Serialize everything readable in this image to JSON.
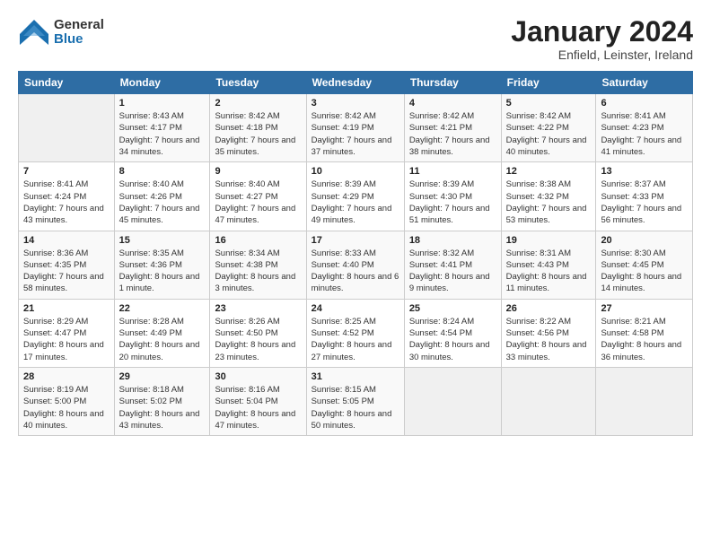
{
  "header": {
    "logo_general": "General",
    "logo_blue": "Blue",
    "month": "January 2024",
    "location": "Enfield, Leinster, Ireland"
  },
  "weekdays": [
    "Sunday",
    "Monday",
    "Tuesday",
    "Wednesday",
    "Thursday",
    "Friday",
    "Saturday"
  ],
  "weeks": [
    [
      {
        "day": "",
        "sunrise": "",
        "sunset": "",
        "daylight": ""
      },
      {
        "day": "1",
        "sunrise": "Sunrise: 8:43 AM",
        "sunset": "Sunset: 4:17 PM",
        "daylight": "Daylight: 7 hours and 34 minutes."
      },
      {
        "day": "2",
        "sunrise": "Sunrise: 8:42 AM",
        "sunset": "Sunset: 4:18 PM",
        "daylight": "Daylight: 7 hours and 35 minutes."
      },
      {
        "day": "3",
        "sunrise": "Sunrise: 8:42 AM",
        "sunset": "Sunset: 4:19 PM",
        "daylight": "Daylight: 7 hours and 37 minutes."
      },
      {
        "day": "4",
        "sunrise": "Sunrise: 8:42 AM",
        "sunset": "Sunset: 4:21 PM",
        "daylight": "Daylight: 7 hours and 38 minutes."
      },
      {
        "day": "5",
        "sunrise": "Sunrise: 8:42 AM",
        "sunset": "Sunset: 4:22 PM",
        "daylight": "Daylight: 7 hours and 40 minutes."
      },
      {
        "day": "6",
        "sunrise": "Sunrise: 8:41 AM",
        "sunset": "Sunset: 4:23 PM",
        "daylight": "Daylight: 7 hours and 41 minutes."
      }
    ],
    [
      {
        "day": "7",
        "sunrise": "Sunrise: 8:41 AM",
        "sunset": "Sunset: 4:24 PM",
        "daylight": "Daylight: 7 hours and 43 minutes."
      },
      {
        "day": "8",
        "sunrise": "Sunrise: 8:40 AM",
        "sunset": "Sunset: 4:26 PM",
        "daylight": "Daylight: 7 hours and 45 minutes."
      },
      {
        "day": "9",
        "sunrise": "Sunrise: 8:40 AM",
        "sunset": "Sunset: 4:27 PM",
        "daylight": "Daylight: 7 hours and 47 minutes."
      },
      {
        "day": "10",
        "sunrise": "Sunrise: 8:39 AM",
        "sunset": "Sunset: 4:29 PM",
        "daylight": "Daylight: 7 hours and 49 minutes."
      },
      {
        "day": "11",
        "sunrise": "Sunrise: 8:39 AM",
        "sunset": "Sunset: 4:30 PM",
        "daylight": "Daylight: 7 hours and 51 minutes."
      },
      {
        "day": "12",
        "sunrise": "Sunrise: 8:38 AM",
        "sunset": "Sunset: 4:32 PM",
        "daylight": "Daylight: 7 hours and 53 minutes."
      },
      {
        "day": "13",
        "sunrise": "Sunrise: 8:37 AM",
        "sunset": "Sunset: 4:33 PM",
        "daylight": "Daylight: 7 hours and 56 minutes."
      }
    ],
    [
      {
        "day": "14",
        "sunrise": "Sunrise: 8:36 AM",
        "sunset": "Sunset: 4:35 PM",
        "daylight": "Daylight: 7 hours and 58 minutes."
      },
      {
        "day": "15",
        "sunrise": "Sunrise: 8:35 AM",
        "sunset": "Sunset: 4:36 PM",
        "daylight": "Daylight: 8 hours and 1 minute."
      },
      {
        "day": "16",
        "sunrise": "Sunrise: 8:34 AM",
        "sunset": "Sunset: 4:38 PM",
        "daylight": "Daylight: 8 hours and 3 minutes."
      },
      {
        "day": "17",
        "sunrise": "Sunrise: 8:33 AM",
        "sunset": "Sunset: 4:40 PM",
        "daylight": "Daylight: 8 hours and 6 minutes."
      },
      {
        "day": "18",
        "sunrise": "Sunrise: 8:32 AM",
        "sunset": "Sunset: 4:41 PM",
        "daylight": "Daylight: 8 hours and 9 minutes."
      },
      {
        "day": "19",
        "sunrise": "Sunrise: 8:31 AM",
        "sunset": "Sunset: 4:43 PM",
        "daylight": "Daylight: 8 hours and 11 minutes."
      },
      {
        "day": "20",
        "sunrise": "Sunrise: 8:30 AM",
        "sunset": "Sunset: 4:45 PM",
        "daylight": "Daylight: 8 hours and 14 minutes."
      }
    ],
    [
      {
        "day": "21",
        "sunrise": "Sunrise: 8:29 AM",
        "sunset": "Sunset: 4:47 PM",
        "daylight": "Daylight: 8 hours and 17 minutes."
      },
      {
        "day": "22",
        "sunrise": "Sunrise: 8:28 AM",
        "sunset": "Sunset: 4:49 PM",
        "daylight": "Daylight: 8 hours and 20 minutes."
      },
      {
        "day": "23",
        "sunrise": "Sunrise: 8:26 AM",
        "sunset": "Sunset: 4:50 PM",
        "daylight": "Daylight: 8 hours and 23 minutes."
      },
      {
        "day": "24",
        "sunrise": "Sunrise: 8:25 AM",
        "sunset": "Sunset: 4:52 PM",
        "daylight": "Daylight: 8 hours and 27 minutes."
      },
      {
        "day": "25",
        "sunrise": "Sunrise: 8:24 AM",
        "sunset": "Sunset: 4:54 PM",
        "daylight": "Daylight: 8 hours and 30 minutes."
      },
      {
        "day": "26",
        "sunrise": "Sunrise: 8:22 AM",
        "sunset": "Sunset: 4:56 PM",
        "daylight": "Daylight: 8 hours and 33 minutes."
      },
      {
        "day": "27",
        "sunrise": "Sunrise: 8:21 AM",
        "sunset": "Sunset: 4:58 PM",
        "daylight": "Daylight: 8 hours and 36 minutes."
      }
    ],
    [
      {
        "day": "28",
        "sunrise": "Sunrise: 8:19 AM",
        "sunset": "Sunset: 5:00 PM",
        "daylight": "Daylight: 8 hours and 40 minutes."
      },
      {
        "day": "29",
        "sunrise": "Sunrise: 8:18 AM",
        "sunset": "Sunset: 5:02 PM",
        "daylight": "Daylight: 8 hours and 43 minutes."
      },
      {
        "day": "30",
        "sunrise": "Sunrise: 8:16 AM",
        "sunset": "Sunset: 5:04 PM",
        "daylight": "Daylight: 8 hours and 47 minutes."
      },
      {
        "day": "31",
        "sunrise": "Sunrise: 8:15 AM",
        "sunset": "Sunset: 5:05 PM",
        "daylight": "Daylight: 8 hours and 50 minutes."
      },
      {
        "day": "",
        "sunrise": "",
        "sunset": "",
        "daylight": ""
      },
      {
        "day": "",
        "sunrise": "",
        "sunset": "",
        "daylight": ""
      },
      {
        "day": "",
        "sunrise": "",
        "sunset": "",
        "daylight": ""
      }
    ]
  ]
}
